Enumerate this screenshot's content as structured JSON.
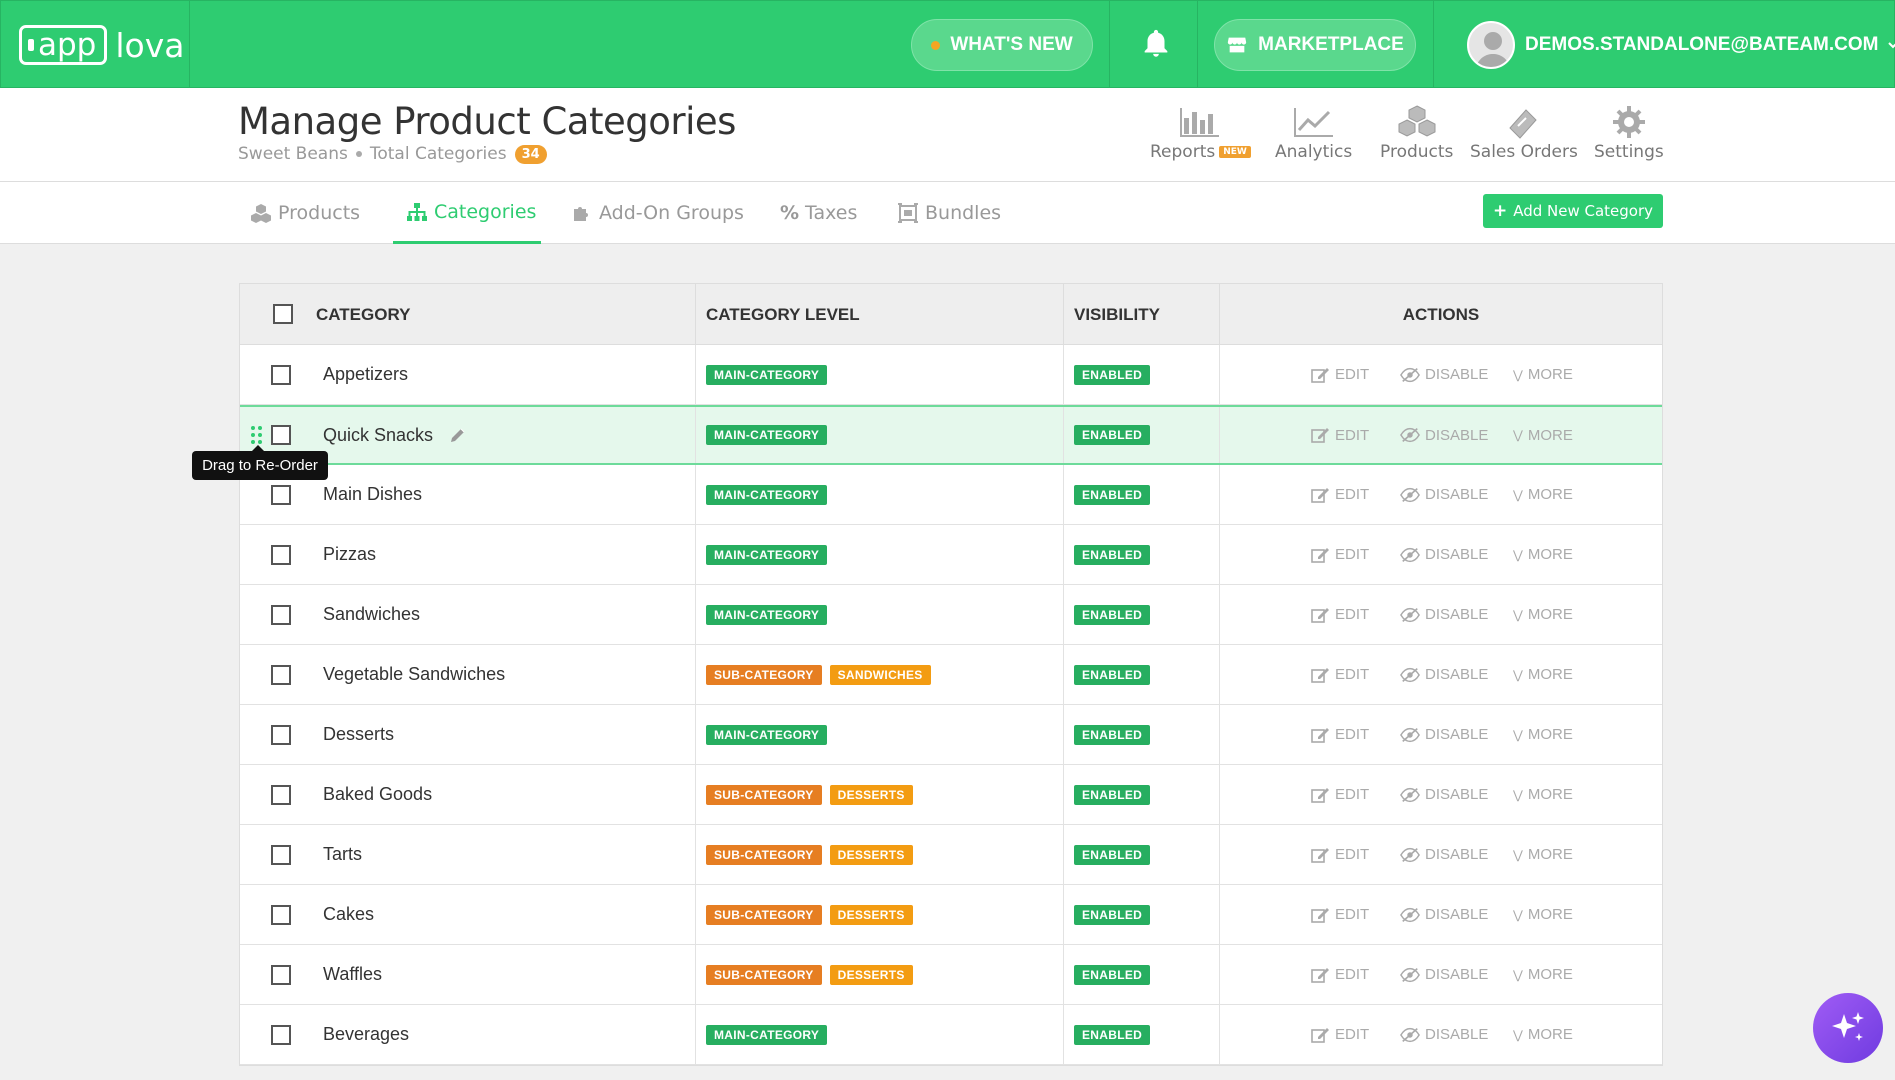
{
  "app": {
    "logo_app": "app",
    "logo_lova": "lova"
  },
  "topbar": {
    "whats_new": "WHAT'S NEW",
    "marketplace": "MARKETPLACE",
    "user_email": "DEMOS.STANDALONE@BATEAM.COM",
    "accent": "#2ecc71",
    "notification_dot": "#f5a623"
  },
  "header": {
    "title": "Manage Product Categories",
    "store": "Sweet Beans",
    "total_label": "Total Categories",
    "total_count": "34",
    "quick_links": [
      {
        "label": "Reports",
        "icon": "bar-chart-icon",
        "tag": "NEW"
      },
      {
        "label": "Analytics",
        "icon": "line-chart-icon"
      },
      {
        "label": "Products",
        "icon": "cubes-icon"
      },
      {
        "label": "Sales Orders",
        "icon": "ticket-icon"
      },
      {
        "label": "Settings",
        "icon": "gear-icon"
      }
    ]
  },
  "tabs": [
    {
      "label": "Products",
      "icon": "cubes-icon"
    },
    {
      "label": "Categories",
      "icon": "sitemap-icon",
      "active": true
    },
    {
      "label": "Add-On Groups",
      "icon": "puzzle-icon"
    },
    {
      "label": "Taxes",
      "icon": "percent-icon"
    },
    {
      "label": "Bundles",
      "icon": "bundle-icon"
    }
  ],
  "add_button": "Add New Category",
  "table": {
    "headers": {
      "category": "CATEGORY",
      "level": "CATEGORY LEVEL",
      "visibility": "VISIBILITY",
      "actions": "ACTIONS"
    },
    "actions": {
      "edit": "EDIT",
      "disable": "DISABLE",
      "more": "MORE"
    },
    "rows": [
      {
        "name": "Appetizers",
        "level": "MAIN-CATEGORY",
        "parent": "",
        "visibility": "ENABLED"
      },
      {
        "name": "Quick Snacks",
        "level": "MAIN-CATEGORY",
        "parent": "",
        "visibility": "ENABLED"
      },
      {
        "name": "Main Dishes",
        "level": "MAIN-CATEGORY",
        "parent": "",
        "visibility": "ENABLED"
      },
      {
        "name": "Pizzas",
        "level": "MAIN-CATEGORY",
        "parent": "",
        "visibility": "ENABLED"
      },
      {
        "name": "Sandwiches",
        "level": "MAIN-CATEGORY",
        "parent": "",
        "visibility": "ENABLED"
      },
      {
        "name": "Vegetable Sandwiches",
        "level": "SUB-CATEGORY",
        "parent": "SANDWICHES",
        "visibility": "ENABLED"
      },
      {
        "name": "Desserts",
        "level": "MAIN-CATEGORY",
        "parent": "",
        "visibility": "ENABLED"
      },
      {
        "name": "Baked Goods",
        "level": "SUB-CATEGORY",
        "parent": "DESSERTS",
        "visibility": "ENABLED"
      },
      {
        "name": "Tarts",
        "level": "SUB-CATEGORY",
        "parent": "DESSERTS",
        "visibility": "ENABLED"
      },
      {
        "name": "Cakes",
        "level": "SUB-CATEGORY",
        "parent": "DESSERTS",
        "visibility": "ENABLED"
      },
      {
        "name": "Waffles",
        "level": "SUB-CATEGORY",
        "parent": "DESSERTS",
        "visibility": "ENABLED"
      },
      {
        "name": "Beverages",
        "level": "MAIN-CATEGORY",
        "parent": "",
        "visibility": "ENABLED"
      }
    ]
  },
  "tooltip": "Drag to Re-Order"
}
